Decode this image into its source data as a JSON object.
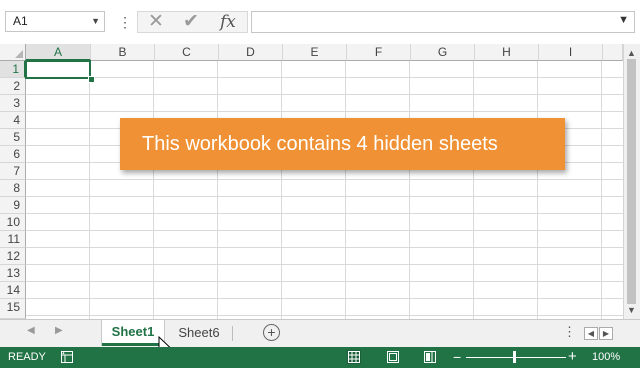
{
  "formula_bar": {
    "name_box": "A1",
    "fx_label": "fx",
    "formula_value": ""
  },
  "columns": [
    "A",
    "B",
    "C",
    "D",
    "E",
    "F",
    "G",
    "H",
    "I"
  ],
  "rows": [
    "1",
    "2",
    "3",
    "4",
    "5",
    "6",
    "7",
    "8",
    "9",
    "10",
    "11",
    "12",
    "13",
    "14",
    "15"
  ],
  "active_cell": "A1",
  "banner": {
    "text": "This workbook contains 4 hidden sheets",
    "color": "#ef9134"
  },
  "sheet_tabs": [
    {
      "label": "Sheet1",
      "active": true
    },
    {
      "label": "Sheet6",
      "active": false
    }
  ],
  "status_bar": {
    "status": "READY",
    "zoom": "100%",
    "zoom_percent": 100,
    "color": "#217346"
  },
  "icons": [
    "cancel-icon",
    "enter-icon",
    "insert-function-icon",
    "add-sheet-icon",
    "macro-record-icon",
    "normal-view-icon",
    "page-layout-icon",
    "page-break-icon"
  ]
}
